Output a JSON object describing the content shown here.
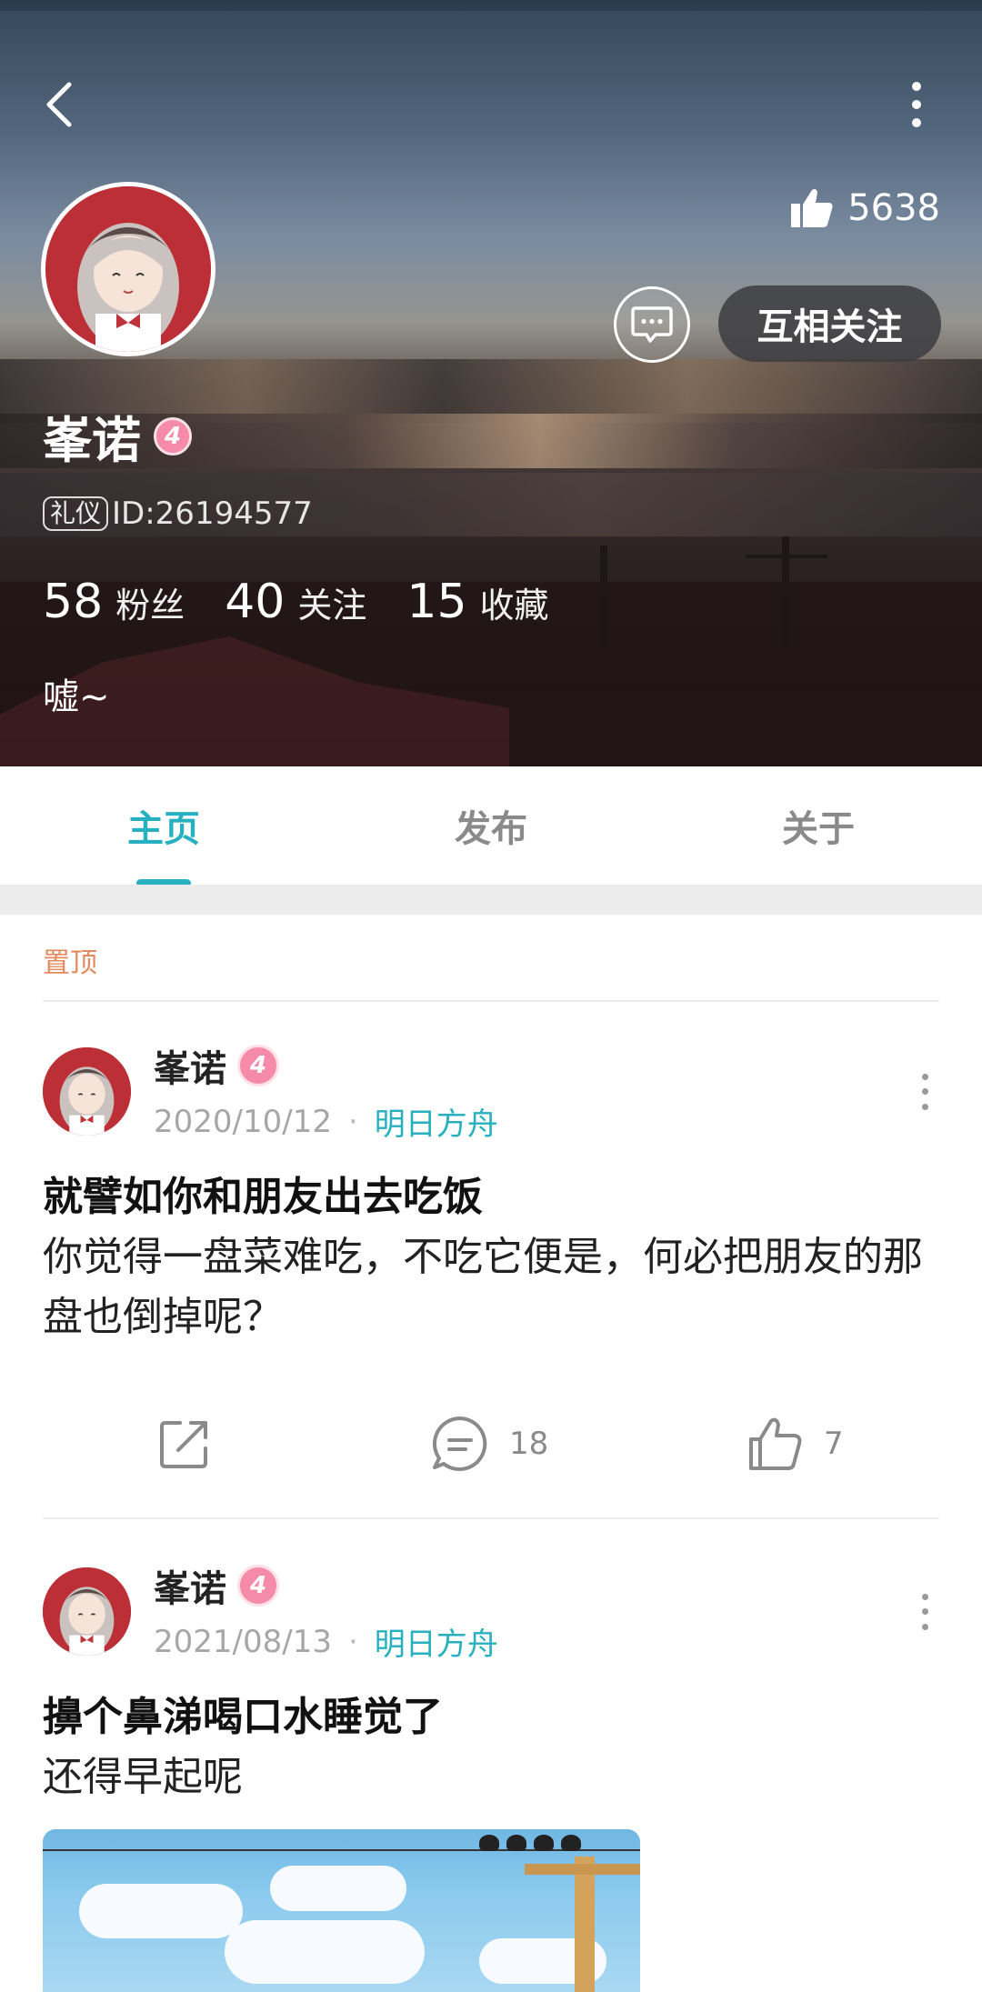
{
  "header": {
    "likes_count": "5638",
    "follow_label": "互相关注",
    "username": "峯诺",
    "level": "4",
    "id_tag": "礼仪",
    "id_text": "ID:26194577",
    "stats": [
      {
        "num": "58",
        "label": "粉丝"
      },
      {
        "num": "40",
        "label": "关注"
      },
      {
        "num": "15",
        "label": "收藏"
      }
    ],
    "bio": "嘘~"
  },
  "tabs": [
    {
      "label": "主页",
      "active": true
    },
    {
      "label": "发布",
      "active": false
    },
    {
      "label": "关于",
      "active": false
    }
  ],
  "feed": {
    "pinned_label": "置顶",
    "posts": [
      {
        "author": "峯诺",
        "level": "4",
        "date": "2020/10/12",
        "channel": "明日方舟",
        "title": "就譬如你和朋友出去吃饭",
        "body": "你觉得一盘菜难吃，不吃它便是，何必把朋友的那盘也倒掉呢？",
        "comments": "18",
        "likes": "7"
      },
      {
        "author": "峯诺",
        "level": "4",
        "date": "2021/08/13",
        "channel": "明日方舟",
        "title": "擤个鼻涕喝口水睡觉了",
        "body": "还得早起呢"
      }
    ]
  },
  "colors": {
    "accent": "#27b1c0",
    "pinned": "#e38b5e",
    "level_badge": "#f58aaa"
  },
  "icons": [
    "back-arrow-icon",
    "more-vertical-icon",
    "thumbs-up-icon",
    "message-icon",
    "share-icon",
    "comment-icon",
    "like-icon"
  ]
}
